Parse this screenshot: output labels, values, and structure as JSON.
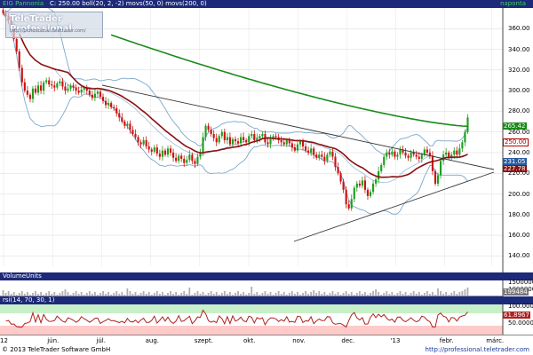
{
  "header": {
    "symbol": "EIG Pannonia",
    "indicators": "C: 250.00 boll(20, 2, -2) movs(50, 0) movs(200, 0)",
    "period": "naponta"
  },
  "watermark": {
    "title": "TeleTrader Professional",
    "url": "http://professional.teletrader.com/"
  },
  "volume_header": "VolumeUnits",
  "rsi_header": "rsi(14, 70, 30, 1)",
  "copyright": "© 2013 TeleTrader Software GmbH",
  "footer_url": "http://professional.teletrader.com",
  "colors": {
    "panel_header": "#1d2a79",
    "candle_up": "#1e9e1e",
    "candle_down": "#cc1111",
    "movs50": "#8b1010",
    "movs200": "#1a8a1a",
    "bollinger": "#7aa7cc",
    "trendline": "#333333",
    "rsi_band": "#c8f0c8",
    "rsi_low_band": "#ffcaca",
    "rsi_line": "#b02020",
    "volume_bar": "#b0b0b0",
    "price_tag_close": "#b00000",
    "price_tag_ma200": "#1a8a1a",
    "price_tag_ma50": "#8b1010",
    "price_tag_bb": "#2a5aa0"
  },
  "chart_data": {
    "type": "candlestick",
    "title": "EIG Pannonia",
    "xlabel": "",
    "ylabel": "",
    "ylim": [
      130,
      380
    ],
    "y_ticks": [
      140,
      160,
      180,
      200,
      220,
      240,
      260,
      280,
      300,
      320,
      340,
      360
    ],
    "x_ticks": [
      "12",
      "jún.",
      "júl.",
      "aug.",
      "szept.",
      "okt.",
      "nov.",
      "dec.",
      "'13",
      "febr.",
      "márc."
    ],
    "grid": true,
    "last_values": {
      "close": 250.0,
      "movs200": 265.42,
      "movs50": 227.78,
      "boll_upper": 231.05
    },
    "price_closes": [
      375,
      372,
      368,
      360,
      350,
      338,
      322,
      308,
      300,
      296,
      292,
      302,
      298,
      305,
      300,
      308,
      310,
      306,
      305,
      303,
      307,
      309,
      304,
      300,
      302,
      305,
      303,
      300,
      298,
      301,
      303,
      300,
      296,
      293,
      297,
      299,
      294,
      290,
      286,
      288,
      284,
      283,
      278,
      274,
      270,
      266,
      268,
      262,
      258,
      255,
      250,
      248,
      252,
      246,
      243,
      241,
      245,
      239,
      236,
      242,
      238,
      244,
      240,
      235,
      232,
      237,
      234,
      230,
      233,
      238,
      232,
      229,
      236,
      240,
      255,
      266,
      262,
      258,
      254,
      250,
      256,
      260,
      252,
      255,
      248,
      253,
      251,
      249,
      255,
      252,
      250,
      256,
      258,
      252,
      254,
      256,
      258,
      250,
      248,
      253,
      256,
      255,
      252,
      250,
      248,
      252,
      249,
      245,
      242,
      248,
      251,
      246,
      242,
      240,
      244,
      238,
      235,
      238,
      236,
      232,
      238,
      241,
      236,
      226,
      220,
      212,
      204,
      190,
      186,
      195,
      206,
      210,
      208,
      213,
      204,
      198,
      202,
      210,
      214,
      222,
      228,
      236,
      240,
      238,
      241,
      236,
      238,
      243,
      240,
      237,
      235,
      240,
      238,
      236,
      234,
      238,
      243,
      240,
      237,
      222,
      210,
      218,
      232,
      238,
      240,
      236,
      238,
      242,
      238,
      244,
      250,
      260,
      274
    ],
    "movs50": [
      null,
      null,
      null,
      null,
      null,
      null,
      null,
      null,
      null,
      null,
      null,
      null,
      null,
      null,
      null,
      null,
      null,
      null,
      null,
      null,
      null,
      null,
      null,
      null,
      null,
      null,
      null,
      null,
      null,
      null,
      null,
      null,
      null,
      null,
      null,
      null,
      null,
      null,
      null,
      null,
      null,
      null,
      null,
      null,
      null,
      null,
      null,
      null,
      null,
      null,
      300,
      296,
      293,
      291,
      289,
      287,
      285,
      283,
      281,
      279,
      277,
      275,
      273,
      271,
      270,
      268,
      267,
      266,
      265,
      264,
      263,
      262,
      261,
      260,
      260,
      259,
      258,
      257,
      256,
      256,
      255,
      254,
      253,
      252,
      251,
      251,
      250,
      249,
      249,
      248,
      248,
      248,
      247,
      247,
      247,
      247,
      247,
      247,
      247,
      247,
      247,
      247,
      247,
      247,
      247,
      246,
      246,
      246,
      245,
      245,
      245,
      244,
      244,
      243,
      242,
      241,
      240,
      239,
      238,
      237,
      236,
      235,
      234,
      233,
      231,
      229,
      227,
      225,
      223,
      221,
      219,
      218,
      217,
      216,
      215,
      214,
      213,
      213,
      213,
      213,
      213,
      214,
      214,
      215,
      216,
      217,
      218,
      219,
      220,
      221,
      222,
      223,
      223,
      224,
      224,
      225,
      225,
      226,
      226,
      226,
      226,
      226,
      226,
      226,
      227,
      227,
      227,
      227,
      227,
      227,
      228
    ],
    "movs200": [
      null,
      null,
      null,
      null,
      null,
      null,
      null,
      null,
      null,
      null,
      null,
      null,
      null,
      null,
      null,
      null,
      null,
      null,
      null,
      null,
      null,
      null,
      null,
      null,
      null,
      null,
      null,
      null,
      null,
      null,
      null,
      null,
      null,
      null,
      null,
      null,
      null,
      null,
      null,
      null,
      null,
      null,
      null,
      null,
      null,
      null,
      null,
      null,
      null,
      null,
      null,
      null,
      null,
      null,
      null,
      null,
      null,
      null,
      null,
      null,
      null,
      null,
      null,
      null,
      null,
      null,
      null,
      null,
      null,
      null,
      null,
      null,
      null,
      null,
      null,
      null,
      null,
      null,
      null,
      null,
      null,
      null,
      null,
      null,
      null,
      null,
      null,
      null,
      null,
      null,
      null,
      null,
      null,
      null,
      null,
      null,
      null,
      null,
      null,
      null,
      null,
      null,
      null,
      null,
      null,
      null,
      null,
      null,
      null,
      null,
      null,
      null,
      null,
      null,
      null,
      null,
      null,
      null,
      null,
      null,
      null,
      null,
      null,
      null,
      null,
      null,
      null,
      null,
      null,
      null,
      null,
      null,
      null,
      null,
      null,
      null,
      null,
      null,
      null,
      null,
      null,
      null,
      null,
      null,
      null,
      null,
      null,
      null,
      null,
      null,
      null,
      null,
      null,
      null,
      null,
      null,
      null,
      null,
      null,
      null,
      null,
      null,
      null,
      null,
      null,
      null,
      null,
      null,
      null,
      null,
      null,
      null,
      null,
      null
    ],
    "movs200_path": [
      [
        0,
        392
      ],
      [
        20,
        388
      ],
      [
        40,
        383
      ],
      [
        60,
        378
      ],
      [
        80,
        373
      ],
      [
        100,
        367
      ],
      [
        120,
        361
      ],
      [
        140,
        354
      ],
      [
        160,
        347
      ],
      [
        180,
        340
      ],
      [
        200,
        333
      ],
      [
        220,
        326
      ],
      [
        240,
        319
      ],
      [
        260,
        312
      ],
      [
        280,
        305
      ],
      [
        300,
        298
      ],
      [
        320,
        292
      ],
      [
        340,
        287
      ],
      [
        360,
        282
      ],
      [
        380,
        278
      ],
      [
        400,
        274
      ],
      [
        420,
        271
      ],
      [
        440,
        268
      ],
      [
        460,
        266
      ]
    ],
    "rsi": {
      "value": 61.8967,
      "upper": 70,
      "lower": 30,
      "ylim": [
        0,
        100
      ],
      "y_ticks": [
        50,
        100
      ],
      "tick_labels": [
        "50.0000",
        "100.0000"
      ]
    },
    "volume": {
      "last": 199484,
      "y_ticks": [
        1500000,
        1000000
      ],
      "tick_labels": [
        "1500000",
        "1000000"
      ],
      "last_label": "199484"
    },
    "triangle_upper": [
      [
        115,
        96
      ],
      [
        556,
        191
      ]
    ],
    "triangle_lower": [
      [
        331,
        272
      ],
      [
        556,
        194
      ]
    ],
    "price_tags": [
      {
        "label": "265.42",
        "value": 265.42,
        "kind": "ma200"
      },
      {
        "label": "250.00",
        "value": 250.0,
        "kind": "close"
      },
      {
        "label": "231.05",
        "value": 231.05,
        "kind": "bb"
      },
      {
        "label": "227.78",
        "value": 227.78,
        "kind": "ma50"
      }
    ]
  }
}
